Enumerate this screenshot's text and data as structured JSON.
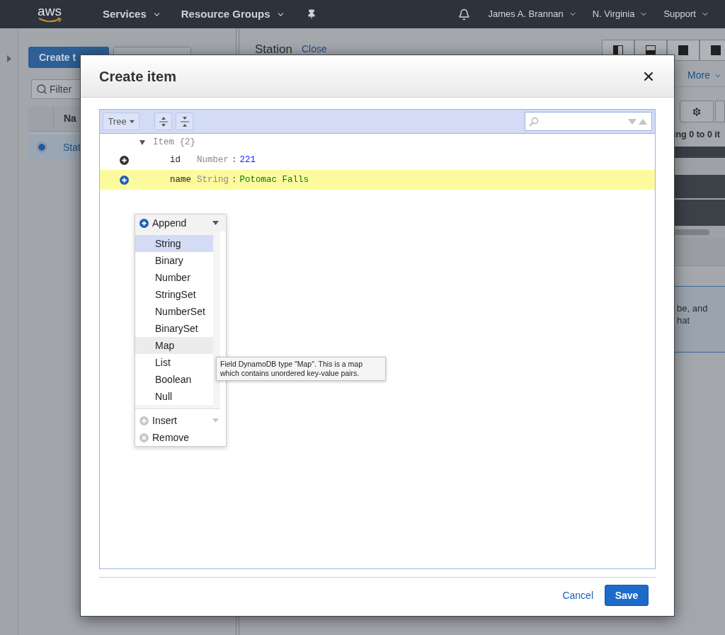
{
  "nav": {
    "logo": "aws",
    "menus": [
      {
        "label": "Services"
      },
      {
        "label": "Resource Groups"
      }
    ],
    "right_menus": [
      {
        "label": "James A. Brannan"
      },
      {
        "label": "N. Virginia"
      },
      {
        "label": "Support"
      }
    ]
  },
  "left_panel": {
    "create_button": "Create t",
    "filter_placeholder": "Filter",
    "column_2": "Na",
    "rows": [
      {
        "selected": true,
        "cell": "Stat"
      }
    ]
  },
  "right_panel": {
    "title": "Station",
    "close_link": "Close",
    "more": "More",
    "status_text": "ing 0 to 0 it",
    "info_lines": [
      "be, and",
      "hat"
    ]
  },
  "dialog": {
    "title": "Create item",
    "mode": "Tree",
    "tree": {
      "label": "Item {2}",
      "expanded": true,
      "children": [
        {
          "field": "id",
          "type": "Number",
          "separator": ":",
          "value": "221",
          "kind": "number",
          "selected": false
        },
        {
          "field": "name",
          "type": "String",
          "separator": ":",
          "value": "Potomac Falls",
          "kind": "string",
          "selected": true
        }
      ]
    },
    "context_menu": {
      "actions": [
        {
          "label": "Append",
          "active": true,
          "kind": "add",
          "has_submenu": true
        },
        {
          "label": "Insert",
          "active": false,
          "kind": "add",
          "has_submenu": true
        },
        {
          "label": "Remove",
          "active": false,
          "kind": "remove",
          "has_submenu": false
        }
      ],
      "types": [
        {
          "label": "String",
          "selected": true,
          "hovered": false
        },
        {
          "label": "Binary",
          "selected": false,
          "hovered": false
        },
        {
          "label": "Number",
          "selected": false,
          "hovered": false
        },
        {
          "label": "StringSet",
          "selected": false,
          "hovered": false
        },
        {
          "label": "NumberSet",
          "selected": false,
          "hovered": false
        },
        {
          "label": "BinarySet",
          "selected": false,
          "hovered": false
        },
        {
          "label": "Map",
          "selected": false,
          "hovered": true
        },
        {
          "label": "List",
          "selected": false,
          "hovered": false
        },
        {
          "label": "Boolean",
          "selected": false,
          "hovered": false
        },
        {
          "label": "Null",
          "selected": false,
          "hovered": false
        }
      ]
    },
    "tooltip_lines": [
      "Field DynamoDB type \"Map\". This is a map",
      "which contains unordered key-value pairs."
    ],
    "cancel": "Cancel",
    "save": "Save"
  }
}
